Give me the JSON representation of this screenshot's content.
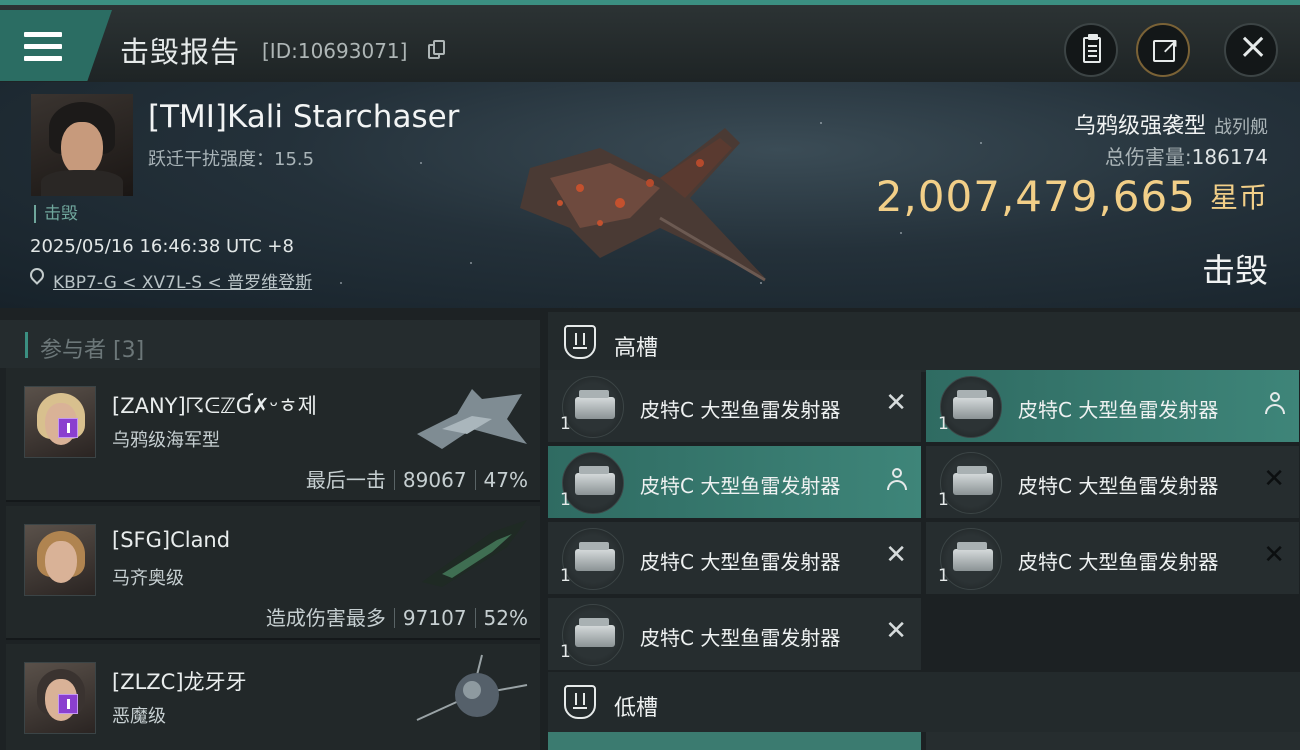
{
  "header": {
    "title": "击毁报告",
    "id_label": "[ID:10693071]",
    "icons": [
      "menu-icon",
      "copy-icon",
      "clipboard-icon",
      "share-icon",
      "close-icon"
    ]
  },
  "victim": {
    "name": "[TMI]Kali Starchaser",
    "warp_scramble": "跃迁干扰强度：15.5",
    "status": "击毁",
    "time": "2025/05/16 16:46:38 UTC +8",
    "location": "KBP7-G < XV7L-S < 普罗维登斯",
    "ship_class": "乌鸦级强袭型",
    "ship_type": "战列舰",
    "total_damage_label": "总伤害量:",
    "total_damage": "186174",
    "isk_value": "2,007,479,665",
    "isk_unit": "星币",
    "result": "击毁"
  },
  "participants": {
    "header": "参与者 [3]",
    "rows": [
      {
        "name": "[ZANY]☈ᕮℤƓ✗ᵕㅎ제",
        "ship": "乌鸦级海军型",
        "tag": "最后一击",
        "damage": "89067",
        "percent": "47%"
      },
      {
        "name": "[SFG]Cland",
        "ship": "马齐奥级",
        "tag": "造成伤害最多",
        "damage": "97107",
        "percent": "52%"
      },
      {
        "name": "[ZLZC]龙牙牙",
        "ship": "恶魔级",
        "tag": "",
        "damage": "",
        "percent": ""
      }
    ]
  },
  "high_slots": {
    "title": "高槽",
    "modules": [
      {
        "name": "皮特C 大型鱼雷发射器",
        "qty": "1",
        "state": "destroyed"
      },
      {
        "name": "皮特C 大型鱼雷发射器",
        "qty": "1",
        "state": "dropped"
      },
      {
        "name": "皮特C 大型鱼雷发射器",
        "qty": "1",
        "state": "dropped"
      },
      {
        "name": "皮特C 大型鱼雷发射器",
        "qty": "1",
        "state": "destroyed-dim"
      },
      {
        "name": "皮特C 大型鱼雷发射器",
        "qty": "1",
        "state": "destroyed"
      },
      {
        "name": "皮特C 大型鱼雷发射器",
        "qty": "1",
        "state": "destroyed-dim"
      },
      {
        "name": "皮特C 大型鱼雷发射器",
        "qty": "1",
        "state": "destroyed"
      }
    ]
  },
  "low_slots": {
    "title": "低槽"
  },
  "colors": {
    "accent": "#3b8f81",
    "isk_gold": "#f2cf88",
    "background": "#1c2123"
  }
}
